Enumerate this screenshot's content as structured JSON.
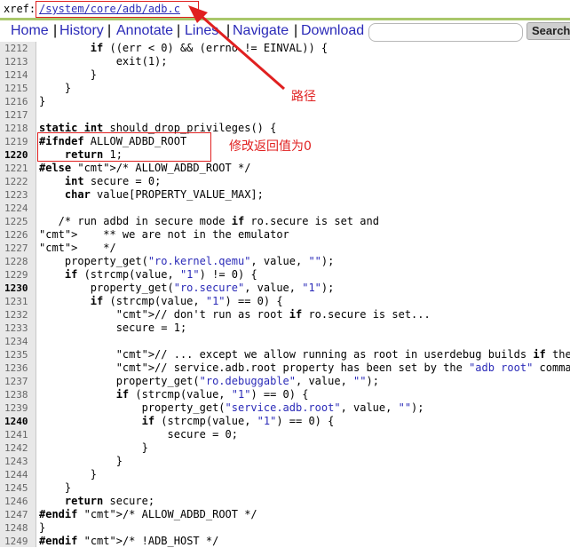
{
  "xref": {
    "label": "xref:",
    "path": "/system/core/adb/adb.c"
  },
  "nav": {
    "links": [
      "Home",
      "History",
      "Annotate",
      "Lines",
      "Navigate",
      "Download"
    ],
    "separator": "|",
    "search_value": "",
    "search_button": "Search"
  },
  "annotations": {
    "path_note": "路径",
    "return_note": "修改返回值为0",
    "color": "#e02020"
  },
  "code_lines": [
    {
      "n": "1212",
      "text": "        if ((err < 0) && (errno != EINVAL)) {"
    },
    {
      "n": "1213",
      "text": "            exit(1);"
    },
    {
      "n": "1214",
      "text": "        }"
    },
    {
      "n": "1215",
      "text": "    }"
    },
    {
      "n": "1216",
      "text": "}"
    },
    {
      "n": "1217",
      "text": ""
    },
    {
      "n": "1218",
      "text": "static int should_drop_privileges() {"
    },
    {
      "n": "1219",
      "text": "#ifndef ALLOW_ADBD_ROOT"
    },
    {
      "n": "1220",
      "text": "    return 1;",
      "bold": true
    },
    {
      "n": "1221",
      "text": "#else /* ALLOW_ADBD_ROOT */"
    },
    {
      "n": "1222",
      "text": "    int secure = 0;"
    },
    {
      "n": "1223",
      "text": "    char value[PROPERTY_VALUE_MAX];"
    },
    {
      "n": "1224",
      "text": ""
    },
    {
      "n": "1225",
      "text": "   /* run adbd in secure mode if ro.secure is set and"
    },
    {
      "n": "1226",
      "text": "    ** we are not in the emulator"
    },
    {
      "n": "1227",
      "text": "    */"
    },
    {
      "n": "1228",
      "text": "    property_get(\"ro.kernel.qemu\", value, \"\");"
    },
    {
      "n": "1229",
      "text": "    if (strcmp(value, \"1\") != 0) {"
    },
    {
      "n": "1230",
      "text": "        property_get(\"ro.secure\", value, \"1\");",
      "bold": true
    },
    {
      "n": "1231",
      "text": "        if (strcmp(value, \"1\") == 0) {"
    },
    {
      "n": "1232",
      "text": "            // don't run as root if ro.secure is set..."
    },
    {
      "n": "1233",
      "text": "            secure = 1;"
    },
    {
      "n": "1234",
      "text": ""
    },
    {
      "n": "1235",
      "text": "            // ... except we allow running as root in userdebug builds if the"
    },
    {
      "n": "1236",
      "text": "            // service.adb.root property has been set by the \"adb root\" command"
    },
    {
      "n": "1237",
      "text": "            property_get(\"ro.debuggable\", value, \"\");"
    },
    {
      "n": "1238",
      "text": "            if (strcmp(value, \"1\") == 0) {"
    },
    {
      "n": "1239",
      "text": "                property_get(\"service.adb.root\", value, \"\");"
    },
    {
      "n": "1240",
      "text": "                if (strcmp(value, \"1\") == 0) {",
      "bold": true
    },
    {
      "n": "1241",
      "text": "                    secure = 0;"
    },
    {
      "n": "1242",
      "text": "                }"
    },
    {
      "n": "1243",
      "text": "            }"
    },
    {
      "n": "1244",
      "text": "        }"
    },
    {
      "n": "1245",
      "text": "    }"
    },
    {
      "n": "1246",
      "text": "    return secure;"
    },
    {
      "n": "1247",
      "text": "#endif /* ALLOW_ADBD_ROOT */"
    },
    {
      "n": "1248",
      "text": "}"
    },
    {
      "n": "1249",
      "text": "#endif /* !ADB_HOST */"
    }
  ]
}
